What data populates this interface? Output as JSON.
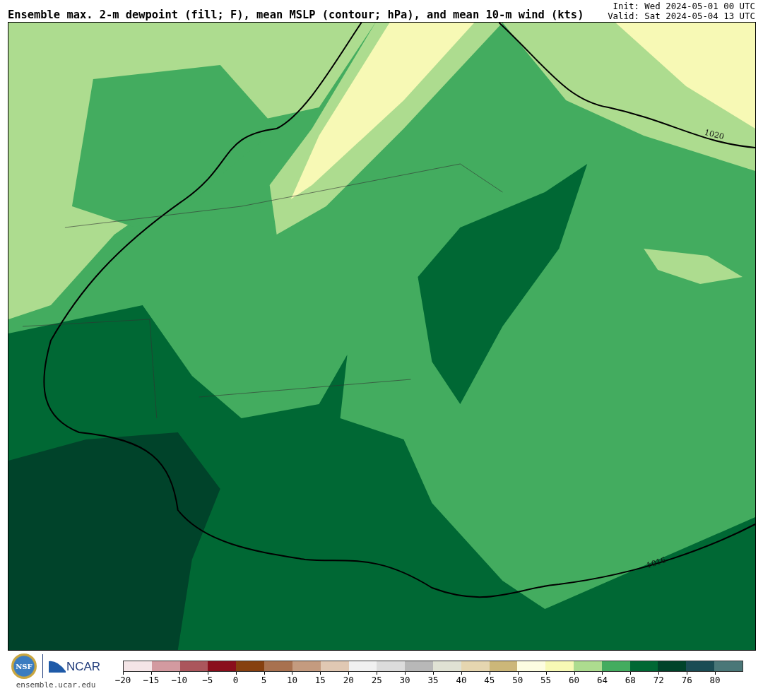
{
  "header": {
    "title": "Ensemble max. 2-m dewpoint (fill; F), mean MSLP (contour; hPa), and mean 10-m wind (kts)",
    "init": "Init: Wed 2024-05-01 00 UTC",
    "valid": "Valid: Sat 2024-05-04 13 UTC"
  },
  "map": {
    "contour_labels": [
      "1020",
      "1016"
    ]
  },
  "footer": {
    "nsf_logo": "NSF",
    "ncar_logo": "NCAR",
    "site": "ensemble.ucar.edu"
  },
  "colorbar": {
    "bins": [
      {
        "color": "#f4e5e7"
      },
      {
        "color": "#d39aa0"
      },
      {
        "color": "#ab565c"
      },
      {
        "color": "#8a0f1c"
      },
      {
        "color": "#86400f"
      },
      {
        "color": "#a8714f"
      },
      {
        "color": "#c49b7f"
      },
      {
        "color": "#e0c8b3"
      },
      {
        "color": "#f0f0f0"
      },
      {
        "color": "#dcdcdc"
      },
      {
        "color": "#b8b8b8"
      },
      {
        "color": "#e0e2d4"
      },
      {
        "color": "#e6d6b0"
      },
      {
        "color": "#ccb779"
      },
      {
        "color": "#fdfde1"
      },
      {
        "color": "#f7f9b5"
      },
      {
        "color": "#addc8f"
      },
      {
        "color": "#43ac5f"
      },
      {
        "color": "#006834"
      },
      {
        "color": "#00432a"
      },
      {
        "color": "#1b4c54"
      },
      {
        "color": "#4a7778"
      }
    ],
    "ticks": [
      "−20",
      "−15",
      "−10",
      "−5",
      "0",
      "5",
      "10",
      "15",
      "20",
      "25",
      "30",
      "35",
      "40",
      "45",
      "50",
      "55",
      "60",
      "64",
      "68",
      "72",
      "76",
      "80"
    ]
  }
}
